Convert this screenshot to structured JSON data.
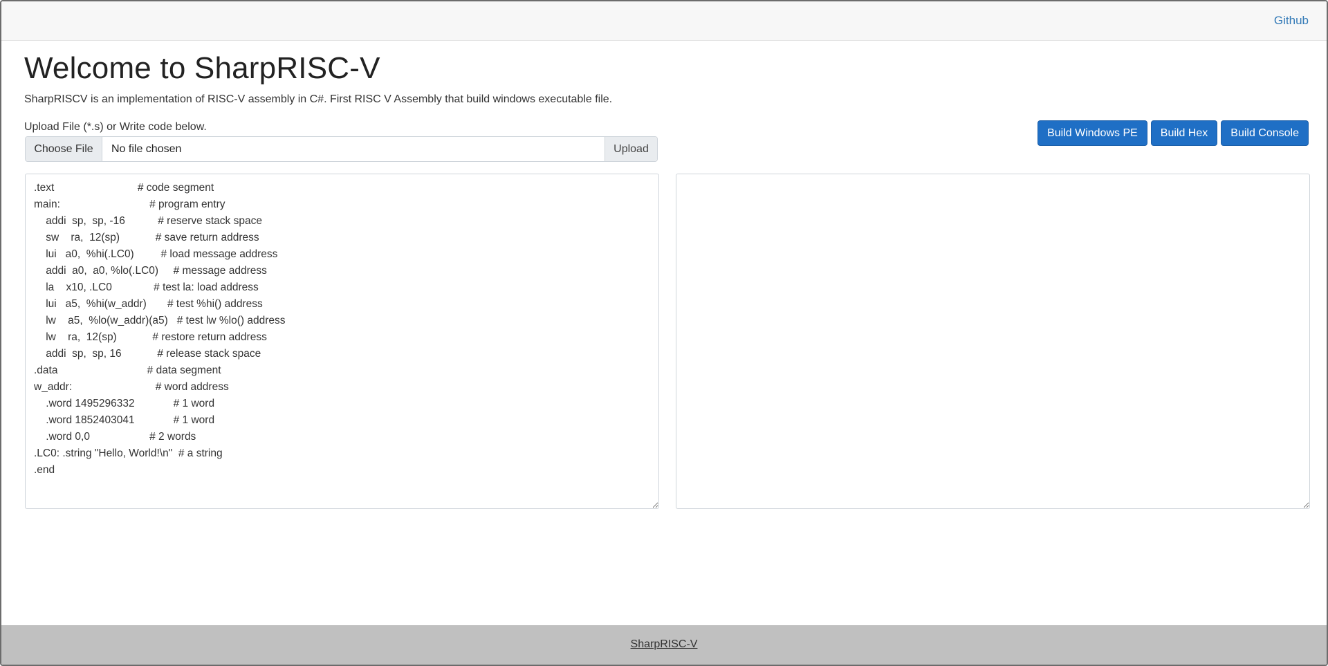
{
  "navbar": {
    "github_label": "Github"
  },
  "main": {
    "title": "Welcome to SharpRISC-V",
    "description": "SharpRISCV is an implementation of RISC-V assembly in C#. First RISC V Assembly that build windows executable file.",
    "upload_label": "Upload File (*.s) or Write code below.",
    "file_input": {
      "button_label": "Choose File",
      "value": "No file chosen",
      "upload_label": "Upload"
    },
    "build_buttons": {
      "windows_pe": "Build Windows PE",
      "hex": "Build Hex",
      "console": "Build Console"
    },
    "code": ".text                            # code segment\nmain:                              # program entry\n    addi  sp,  sp, -16           # reserve stack space\n    sw    ra,  12(sp)            # save return address\n    lui   a0,  %hi(.LC0)         # load message address\n    addi  a0,  a0, %lo(.LC0)     # message address\n    la    x10, .LC0              # test la: load address\n    lui   a5,  %hi(w_addr)       # test %hi() address\n    lw    a5,  %lo(w_addr)(a5)   # test lw %lo() address\n    lw    ra,  12(sp)            # restore return address\n    addi  sp,  sp, 16            # release stack space\n.data                              # data segment\nw_addr:                            # word address\n    .word 1495296332             # 1 word\n    .word 1852403041             # 1 word\n    .word 0,0                    # 2 words\n.LC0: .string \"Hello, World!\\n\"  # a string\n.end",
    "output": ""
  },
  "footer": {
    "label": "SharpRISC-V"
  }
}
